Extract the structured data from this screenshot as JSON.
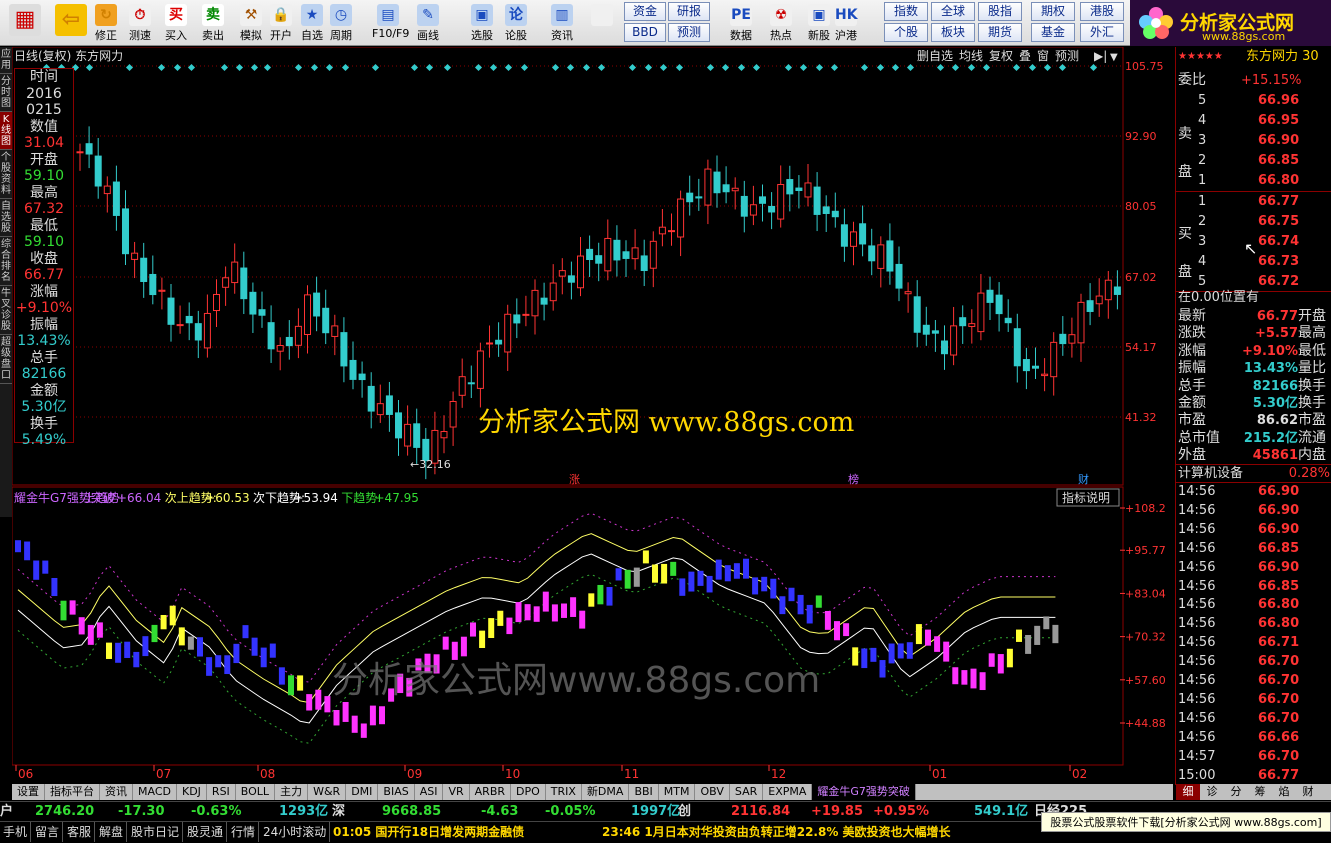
{
  "toolbar": {
    "buttons": [
      "",
      "",
      "修正",
      "测速",
      "买入",
      "卖出",
      "模拟",
      "开户",
      "自选股",
      "周期",
      "F10/F9",
      "画线",
      "选股",
      "论股堂",
      "资讯",
      "",
      "",
      "数据",
      "热点",
      "新股",
      "沪港通"
    ],
    "grid": [
      "资金",
      "研报",
      "BBD",
      "预测",
      "指数",
      "全球",
      "股指",
      "期权",
      "港股",
      "个股",
      "板块",
      "期货",
      "基金",
      "外汇"
    ]
  },
  "logo": {
    "text": "分析家公式网",
    "url": "www.88gs.com"
  },
  "sidebar_tabs": [
    "应用",
    "分时图",
    "K线图",
    "个股资料",
    "自选股",
    "综合排名",
    "牛叉诊股",
    "超级盘口"
  ],
  "chart": {
    "title": "日线(复权)  东方网力",
    "menu": [
      "删自选",
      "均线",
      "复权",
      "叠",
      "窗",
      "预测"
    ],
    "price_labels": [
      "105.75",
      "92.90",
      "80.05",
      "67.02",
      "54.17",
      "41.32"
    ],
    "low_marker": "←32.16",
    "event_tags": [
      "涨",
      "榜",
      "财"
    ],
    "watermark1": "分析家公式网 www.88gs.com",
    "watermark2": "分析家公式网www.88gs.com",
    "indicator_header": "耀金牛G7强势突破",
    "ind_up_label": "上趋势:",
    "ind_up": "+66.04",
    "ind_up2_label": "次上趋势:",
    "ind_up2": "+60.53",
    "ind_down2_label": "次下趋势:",
    "ind_down2": "+53.94",
    "ind_down_label": "下趋势:",
    "ind_down": "+47.95",
    "indicator_btn": "指标说明",
    "ind_labels": [
      "+108.2",
      "+95.77",
      "+83.04",
      "+70.32",
      "+57.60",
      "+44.88"
    ],
    "months": [
      "06",
      "07",
      "08",
      "09",
      "10",
      "11",
      "12",
      "01",
      "02"
    ]
  },
  "info_panel": [
    {
      "k": "时间",
      "v": "2016",
      "c": "#ddd"
    },
    {
      "k": "",
      "v": "0215",
      "c": "#ddd"
    },
    {
      "k": "数值",
      "v": "31.04",
      "c": "#ff3333"
    },
    {
      "k": "开盘",
      "v": "59.10",
      "c": "#33dd33"
    },
    {
      "k": "最高",
      "v": "67.32",
      "c": "#ff3333"
    },
    {
      "k": "最低",
      "v": "59.10",
      "c": "#33dd33"
    },
    {
      "k": "收盘",
      "v": "66.77",
      "c": "#ff3333"
    },
    {
      "k": "涨幅",
      "v": "+9.10%",
      "c": "#ff3333"
    },
    {
      "k": "振幅",
      "v": "13.43%",
      "c": "#33cccc"
    },
    {
      "k": "总手",
      "v": "82166",
      "c": "#33cccc"
    },
    {
      "k": "金额",
      "v": "5.30亿",
      "c": "#33cccc"
    },
    {
      "k": "换手",
      "v": "5.49%",
      "c": "#33cccc"
    }
  ],
  "right_panel": {
    "title": "东方网力 30",
    "weibi_label": "委比",
    "weibi": "+15.15%",
    "sell_label": "卖盘",
    "buy_label": "买盘",
    "sell": [
      [
        "5",
        "66.96"
      ],
      [
        "4",
        "66.95"
      ],
      [
        "3",
        "66.90"
      ],
      [
        "2",
        "66.85"
      ],
      [
        "1",
        "66.80"
      ]
    ],
    "buy": [
      [
        "1",
        "66.77"
      ],
      [
        "2",
        "66.75"
      ],
      [
        "3",
        "66.74"
      ],
      [
        "4",
        "66.73"
      ],
      [
        "5",
        "66.72"
      ]
    ],
    "position": "在0.00位置有",
    "quote": [
      [
        "最新",
        "66.77",
        "开盘"
      ],
      [
        "涨跌",
        "+5.57",
        "最高"
      ],
      [
        "涨幅",
        "+9.10%",
        "最低"
      ],
      [
        "振幅",
        "13.43%",
        "量比"
      ],
      [
        "总手",
        "82166",
        "换手"
      ],
      [
        "金额",
        "5.30亿",
        "换手"
      ],
      [
        "市盈",
        "86.62",
        "市盈"
      ],
      [
        "总市值",
        "215.2亿",
        "流通"
      ],
      [
        "外盘",
        "45861",
        "内盘"
      ]
    ],
    "sector": "计算机设备",
    "sector_pct": "0.28%",
    "ticks": [
      [
        "14:56",
        "66.90"
      ],
      [
        "14:56",
        "66.90"
      ],
      [
        "14:56",
        "66.90"
      ],
      [
        "14:56",
        "66.85"
      ],
      [
        "14:56",
        "66.90"
      ],
      [
        "14:56",
        "66.85"
      ],
      [
        "14:56",
        "66.80"
      ],
      [
        "14:56",
        "66.80"
      ],
      [
        "14:56",
        "66.71"
      ],
      [
        "14:56",
        "66.70"
      ],
      [
        "14:56",
        "66.70"
      ],
      [
        "14:56",
        "66.70"
      ],
      [
        "14:56",
        "66.70"
      ],
      [
        "14:56",
        "66.66"
      ],
      [
        "14:57",
        "66.70"
      ],
      [
        "15:00",
        "66.77"
      ]
    ],
    "bottom_tabs": [
      "细",
      "诊",
      "分",
      "筹",
      "焰",
      "财"
    ]
  },
  "tabbar": [
    "设置",
    "指标平台",
    "资讯",
    "MACD",
    "KDJ",
    "RSI",
    "BOLL",
    "主力",
    "W&R",
    "DMI",
    "BIAS",
    "ASI",
    "VR",
    "ARBR",
    "DPO",
    "TRIX",
    "新DMA",
    "BBI",
    "MTM",
    "OBV",
    "SAR",
    "EXPMA",
    "耀金牛G7强势突破"
  ],
  "status": [
    {
      "t": "户",
      "c": "#ddd"
    },
    {
      "t": "2746.20",
      "c": "#33dd33"
    },
    {
      "t": "-17.30",
      "c": "#33dd33"
    },
    {
      "t": "-0.63%",
      "c": "#33dd33"
    },
    {
      "t": "1293亿",
      "c": "#33cccc"
    },
    {
      "t": "深",
      "c": "#ddd"
    },
    {
      "t": "9668.85",
      "c": "#33dd33"
    },
    {
      "t": "-4.63",
      "c": "#33dd33"
    },
    {
      "t": "-0.05%",
      "c": "#33dd33"
    },
    {
      "t": "1997亿",
      "c": "#33cccc"
    },
    {
      "t": "创",
      "c": "#ddd"
    },
    {
      "t": "2116.84",
      "c": "#ff3333"
    },
    {
      "t": "+19.85",
      "c": "#ff3333"
    },
    {
      "t": "+0.95%",
      "c": "#ff3333"
    },
    {
      "t": "549.1亿",
      "c": "#33cccc"
    },
    {
      "t": "日经225",
      "c": "#ddd"
    }
  ],
  "news": {
    "items": [
      "手机",
      "留言",
      "客服",
      "解盘",
      "股市日记",
      "股灵通",
      "行情",
      "24小时滚动"
    ],
    "n1": "01:05 国开行18日增发两期金融债",
    "n2": "23:46 1月日本对华投资由负转正增22.8% 美欧投资也大幅增长",
    "ad": "股票公式股票软件下载[分析家公式网 www.88gs.com]"
  }
}
